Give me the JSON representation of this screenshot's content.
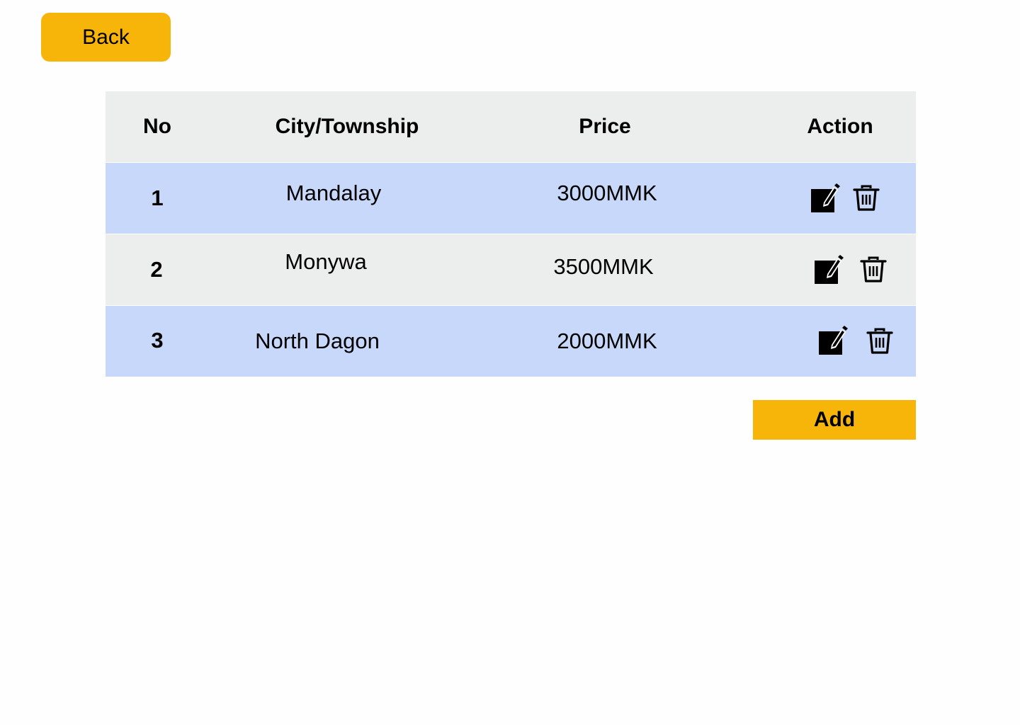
{
  "back_button": {
    "label": "Back"
  },
  "table": {
    "headers": {
      "no": "No",
      "city": "City/Township",
      "price": "Price",
      "action": "Action"
    },
    "rows": [
      {
        "no": "1",
        "city": "Mandalay",
        "price": "3000MMK"
      },
      {
        "no": "2",
        "city": "Monywa",
        "price": "3500MMK"
      },
      {
        "no": "3",
        "city": "North Dagon",
        "price": "2000MMK"
      }
    ],
    "row_icons": {
      "edit": "edit-icon",
      "delete": "trash-icon"
    }
  },
  "add_button": {
    "label": "Add"
  },
  "colors": {
    "accent": "#F7B50A",
    "header_bg": "#ECEEED",
    "row_highlight": "#C7D8FA",
    "row_alt": "#ECEEED"
  }
}
